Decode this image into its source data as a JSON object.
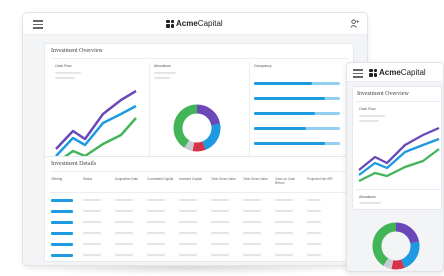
{
  "brand": {
    "bold": "Acme",
    "light": "Capital"
  },
  "overview": {
    "title": "Investment Overview",
    "cash_flow": "Cash Flow",
    "allocations": "Allocations",
    "occupancy": "Occupancy"
  },
  "details": {
    "title": "Investment Details",
    "columns": [
      "Offering",
      "Status",
      "Acquisition Date",
      "Committed Capital",
      "Invested Capital",
      "Total Gross Value",
      "Total Gross Value",
      "Cash on Cash Return",
      "Projected Net IRR"
    ]
  },
  "colors": {
    "blue": "#1e9be0",
    "light_blue": "#93cff0",
    "purple": "#6a48b8",
    "green": "#42b558",
    "red": "#d8324b",
    "gray": "#c9cdd3"
  },
  "allocation_shares": [
    {
      "color": "purple",
      "share": 0.22
    },
    {
      "color": "blue",
      "share": 0.22
    },
    {
      "color": "red",
      "share": 0.09
    },
    {
      "color": "gray",
      "share": 0.06
    },
    {
      "color": "green",
      "share": 0.41
    }
  ],
  "occupancy_levels": [
    0.68,
    0.82,
    0.71,
    0.6,
    0.83
  ],
  "icons": [
    "hamburger-menu-icon",
    "acme-logo-icon",
    "user-add-icon"
  ]
}
